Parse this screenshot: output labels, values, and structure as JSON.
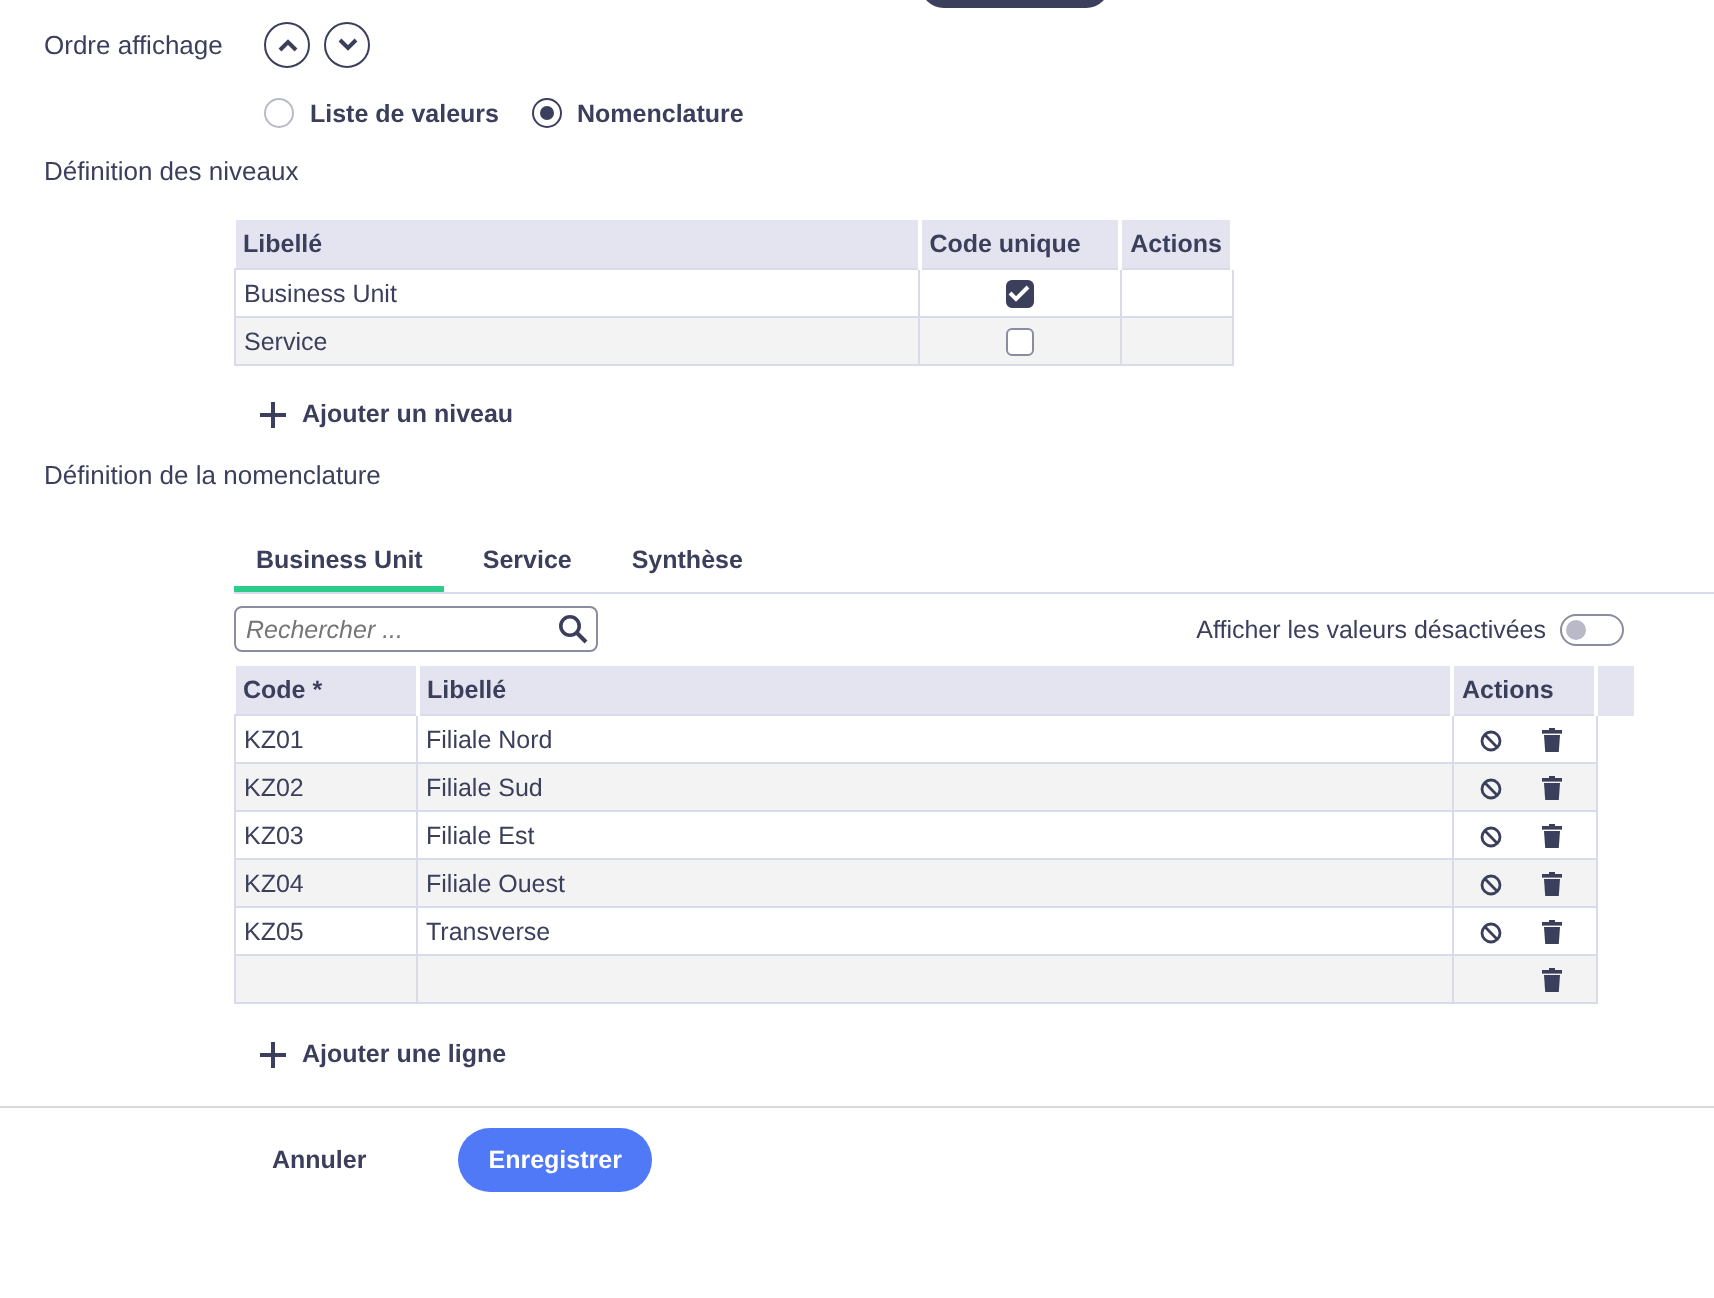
{
  "order": {
    "label": "Ordre affichage"
  },
  "type_options": [
    {
      "label": "Liste de valeurs",
      "selected": false
    },
    {
      "label": "Nomenclature",
      "selected": true
    }
  ],
  "levels": {
    "title": "Définition des niveaux",
    "columns": [
      "Libellé",
      "Code unique",
      "Actions"
    ],
    "rows": [
      {
        "label": "Business Unit",
        "unique": true
      },
      {
        "label": "Service",
        "unique": false
      }
    ],
    "add": "Ajouter un niveau"
  },
  "nomenclature": {
    "title": "Définition de la nomenclature",
    "tabs": [
      {
        "label": "Business Unit",
        "selected": true
      },
      {
        "label": "Service",
        "selected": false
      },
      {
        "label": "Synthèse",
        "selected": false
      }
    ],
    "search": {
      "placeholder": "Rechercher ..."
    },
    "show_disabled": {
      "label": "Afficher les valeurs désactivées",
      "on": false
    },
    "columns": [
      "Code *",
      "Libellé",
      "Actions"
    ],
    "rows": [
      {
        "code": "KZ01",
        "label": "Filiale Nord",
        "can_disable": true
      },
      {
        "code": "KZ02",
        "label": "Filiale Sud",
        "can_disable": true
      },
      {
        "code": "KZ03",
        "label": "Filiale Est",
        "can_disable": true
      },
      {
        "code": "KZ04",
        "label": "Filiale Ouest",
        "can_disable": true
      },
      {
        "code": "KZ05",
        "label": "Transverse",
        "can_disable": true
      },
      {
        "code": "",
        "label": "",
        "can_disable": false
      }
    ],
    "add": "Ajouter une ligne"
  },
  "footer": {
    "cancel": "Annuler",
    "save": "Enregistrer"
  }
}
